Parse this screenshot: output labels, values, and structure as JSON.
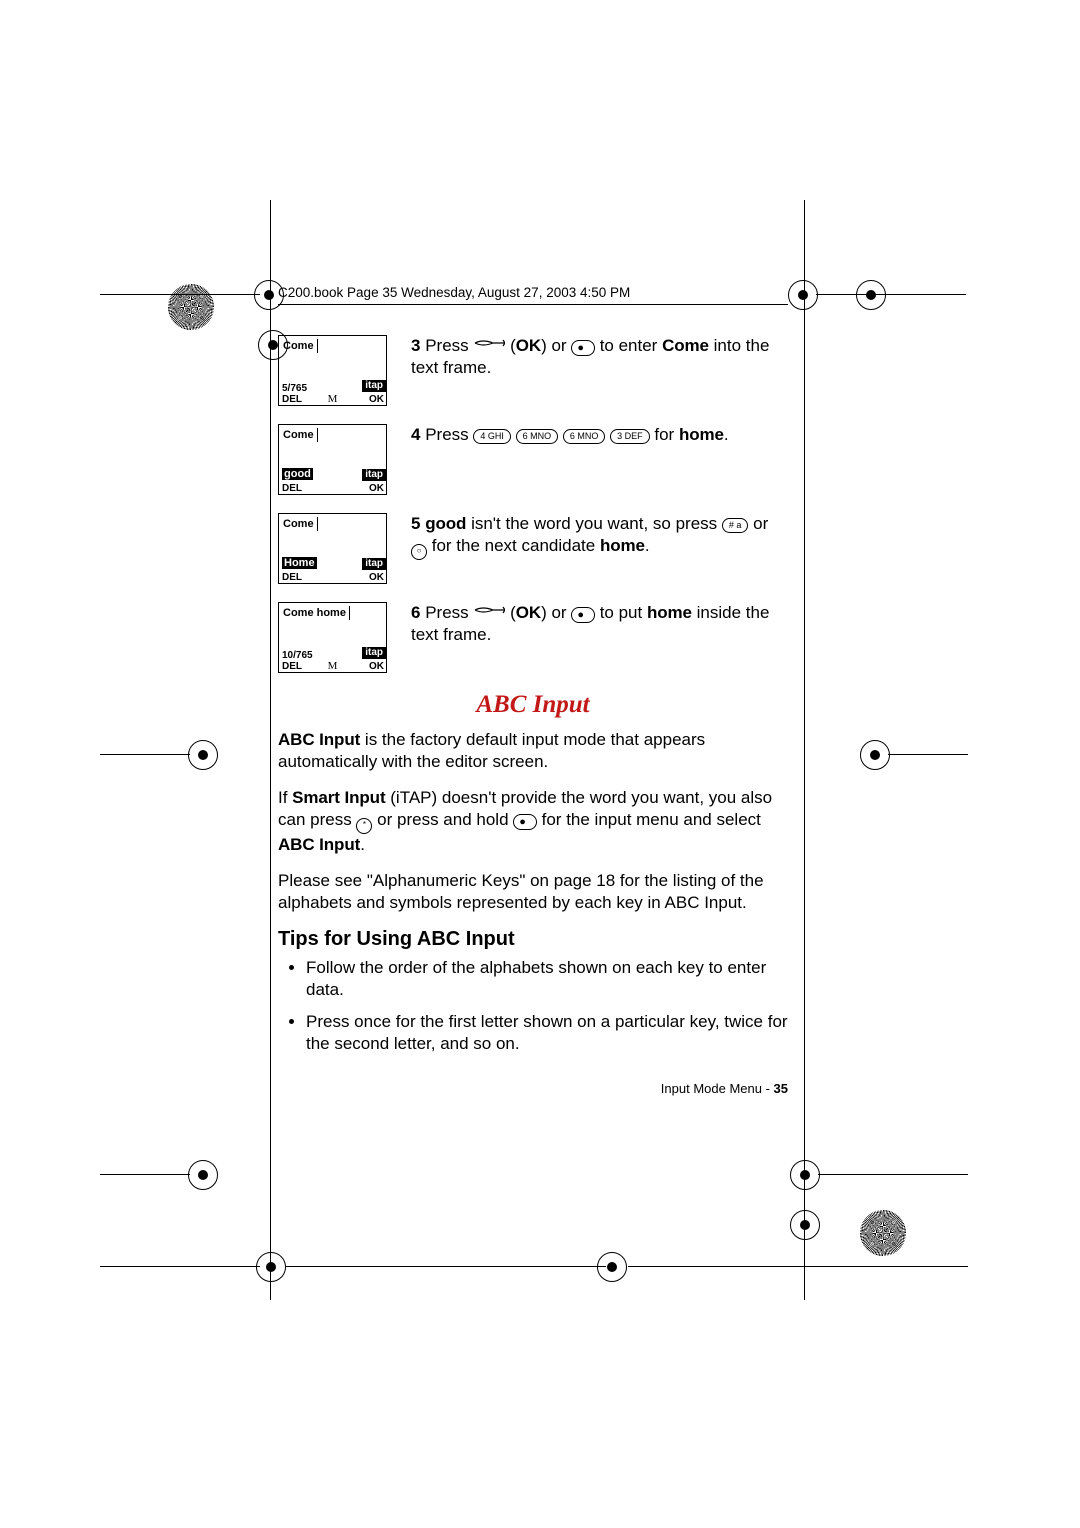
{
  "book_header": "C200.book  Page 35  Wednesday, August 27, 2003  4:50 PM",
  "phones": {
    "p3": {
      "line1": "Come",
      "counter": "5/765",
      "del": "DEL",
      "ok": "OK",
      "itap": "itap",
      "mode": "M"
    },
    "p4": {
      "line1": "Come",
      "candidate": "good",
      "del": "DEL",
      "ok": "OK",
      "itap": "itap"
    },
    "p5": {
      "line1": "Come",
      "candidate": "Home",
      "del": "DEL",
      "ok": "OK",
      "itap": "itap"
    },
    "p6": {
      "line1": "Come home",
      "counter": "10/765",
      "del": "DEL",
      "ok": "OK",
      "itap": "itap",
      "mode": "M"
    }
  },
  "steps": {
    "s3": {
      "num": "3",
      "a": " Press ",
      "ok_label": "OK",
      "b": ") or ",
      "c": " to enter ",
      "word": "Come",
      "d": " into the text frame."
    },
    "s4": {
      "num": "4",
      "a": " Press ",
      "k1": "4 GHI",
      "k2": "6 MNO",
      "k3": "6 MNO",
      "k4": "3 DEF",
      "b": " for ",
      "word": "home",
      "c": "."
    },
    "s5": {
      "num": "5",
      "word1": "good",
      "a": " isn't the word you want, so press ",
      "hash": "# a",
      "b": " or ",
      "c": " for the next candidate ",
      "word2": "home",
      "d": "."
    },
    "s6": {
      "num": "6",
      "a": " Press ",
      "ok_label": "OK",
      "b": ") or ",
      "c": " to put ",
      "word": "home",
      "d": " inside the text frame."
    }
  },
  "section_title": "ABC Input",
  "p_abc1_bold": "ABC Input",
  "p_abc1_rest": " is the factory default input mode that appears automatically with the editor screen.",
  "p_abc2_a": "If ",
  "p_abc2_bold": "Smart Input",
  "p_abc2_b": " (iTAP) doesn't provide the word you want, you also can press ",
  "p_abc2_c": " or press and hold ",
  "p_abc2_d": " for the input menu and select ",
  "p_abc2_bold2": "ABC Input",
  "p_abc2_e": ".",
  "p_abc3": "Please see \"Alphanumeric Keys\" on page 18 for the listing of the alphabets and symbols represented by each key in ABC Input.",
  "tips_title": "Tips for Using ABC Input",
  "tips": [
    "Follow the order of the alphabets shown on each key to enter data.",
    "Press once for the first letter shown on a particular key, twice for the second letter, and so on."
  ],
  "footer_text": "Input Mode Menu - ",
  "footer_page": "35"
}
